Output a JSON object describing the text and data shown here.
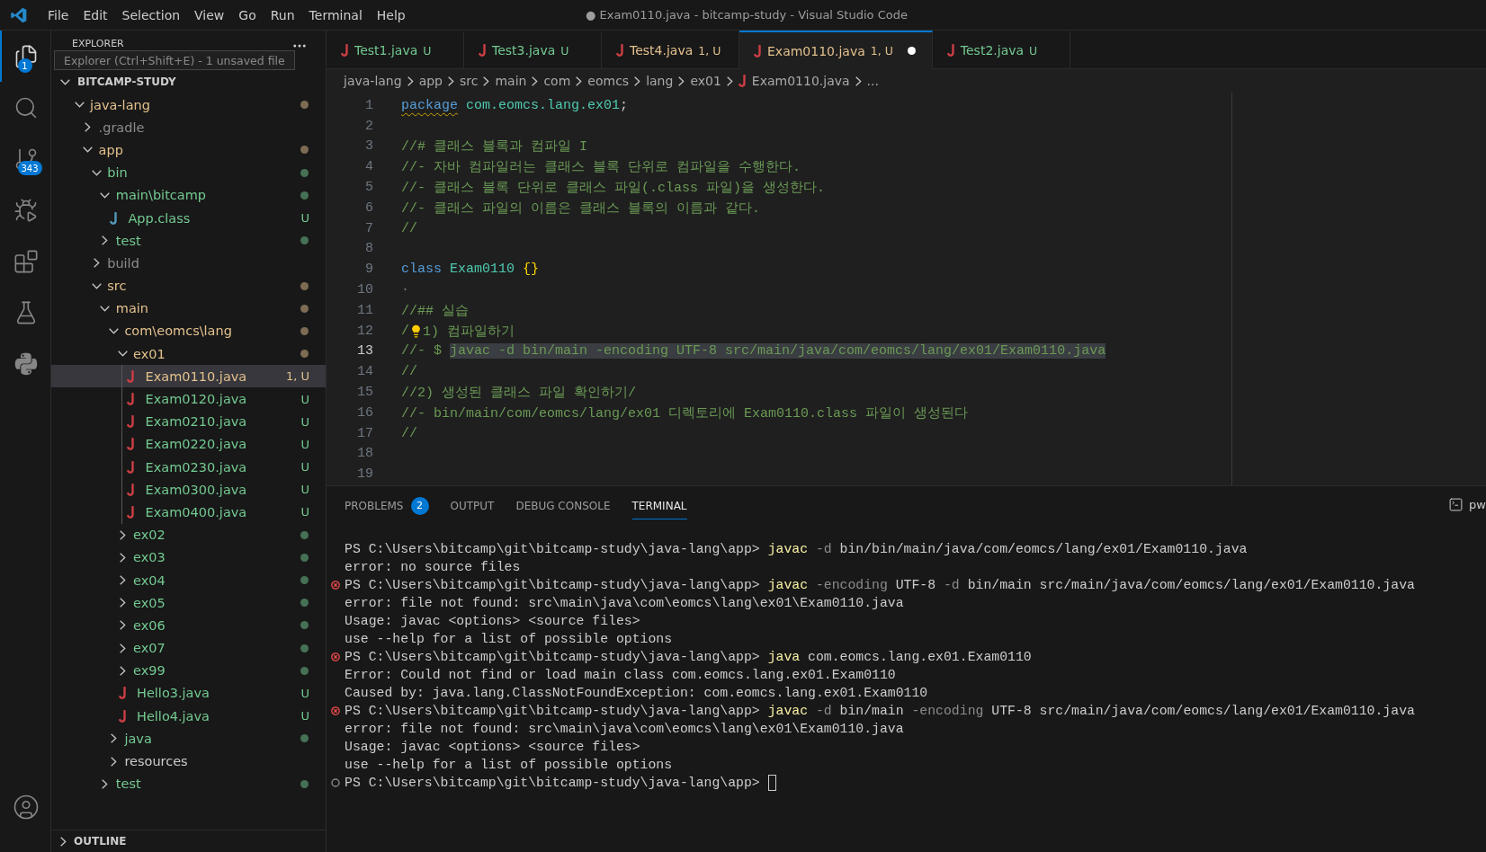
{
  "window": {
    "title": "● Exam0110.java - bitcamp-study - Visual Studio Code"
  },
  "menu": [
    "File",
    "Edit",
    "Selection",
    "View",
    "Go",
    "Run",
    "Terminal",
    "Help"
  ],
  "activity_bar": [
    {
      "kind": "files",
      "selected": true,
      "badge": "1"
    },
    {
      "kind": "search",
      "selected": false
    },
    {
      "kind": "source-control",
      "selected": false,
      "badge": "343"
    },
    {
      "kind": "run-debug",
      "selected": false
    },
    {
      "kind": "extensions",
      "selected": false
    },
    {
      "kind": "testing",
      "selected": false
    },
    {
      "kind": "python",
      "selected": false
    }
  ],
  "sidebar": {
    "header": "EXPLORER",
    "tooltip": "Explorer (Ctrl+Shift+E) - 1 unsaved file",
    "tree": {
      "title": "BITCAMP-STUDY",
      "expanded": true,
      "items": [
        {
          "label": "java-lang",
          "kind": "folder",
          "expanded": true,
          "color": "#e2c08d",
          "dot": true,
          "selected": false,
          "children": [
            {
              "label": ".gradle",
              "kind": "folder",
              "expanded": false,
              "color": "#8c8c8c",
              "dot": false,
              "selected": false
            },
            {
              "label": "app",
              "kind": "folder",
              "expanded": true,
              "color": "#e2c08d",
              "dot": true,
              "selected": false,
              "children": [
                {
                  "label": "bin",
                  "kind": "folder",
                  "expanded": true,
                  "color": "#73c991",
                  "dot": true,
                  "selected": false,
                  "children": [
                    {
                      "label": "main\\bitcamp",
                      "kind": "folder",
                      "expanded": true,
                      "color": "#73c991",
                      "dot": true,
                      "selected": false,
                      "children": [
                        {
                          "label": "App.class",
                          "kind": "class",
                          "color": "#73c991",
                          "badge": "U",
                          "selected": false
                        }
                      ]
                    },
                    {
                      "label": "test",
                      "kind": "folder",
                      "expanded": false,
                      "color": "#73c991",
                      "dot": true,
                      "selected": false
                    }
                  ]
                },
                {
                  "label": "build",
                  "kind": "folder",
                  "expanded": false,
                  "color": "#8c8c8c",
                  "dot": false,
                  "selected": false
                },
                {
                  "label": "src",
                  "kind": "folder",
                  "expanded": true,
                  "color": "#e2c08d",
                  "dot": true,
                  "selected": false,
                  "children": [
                    {
                      "label": "main",
                      "kind": "folder",
                      "expanded": true,
                      "color": "#e2c08d",
                      "dot": true,
                      "selected": false,
                      "children": [
                        {
                          "label": "com\\eomcs\\lang",
                          "kind": "folder",
                          "expanded": true,
                          "color": "#e2c08d",
                          "dot": true,
                          "selected": false,
                          "children": [
                            {
                              "label": "ex01",
                              "kind": "folder",
                              "expanded": true,
                              "color": "#e2c08d",
                              "dot": true,
                              "selected": false,
                              "children": [
                                {
                                  "label": "Exam0110.java",
                                  "kind": "java",
                                  "color": "#e2c08d",
                                  "badge": "1, U",
                                  "selected": true
                                },
                                {
                                  "label": "Exam0120.java",
                                  "kind": "java",
                                  "color": "#73c991",
                                  "badge": "U",
                                  "selected": false
                                },
                                {
                                  "label": "Exam0210.java",
                                  "kind": "java",
                                  "color": "#73c991",
                                  "badge": "U",
                                  "selected": false
                                },
                                {
                                  "label": "Exam0220.java",
                                  "kind": "java",
                                  "color": "#73c991",
                                  "badge": "U",
                                  "selected": false
                                },
                                {
                                  "label": "Exam0230.java",
                                  "kind": "java",
                                  "color": "#73c991",
                                  "badge": "U",
                                  "selected": false
                                },
                                {
                                  "label": "Exam0300.java",
                                  "kind": "java",
                                  "color": "#73c991",
                                  "badge": "U",
                                  "selected": false
                                },
                                {
                                  "label": "Exam0400.java",
                                  "kind": "java",
                                  "color": "#73c991",
                                  "badge": "U",
                                  "selected": false
                                }
                              ]
                            },
                            {
                              "label": "ex02",
                              "kind": "folder",
                              "expanded": false,
                              "color": "#73c991",
                              "dot": true,
                              "selected": false
                            },
                            {
                              "label": "ex03",
                              "kind": "folder",
                              "expanded": false,
                              "color": "#73c991",
                              "dot": true,
                              "selected": false
                            },
                            {
                              "label": "ex04",
                              "kind": "folder",
                              "expanded": false,
                              "color": "#73c991",
                              "dot": true,
                              "selected": false
                            },
                            {
                              "label": "ex05",
                              "kind": "folder",
                              "expanded": false,
                              "color": "#73c991",
                              "dot": true,
                              "selected": false
                            },
                            {
                              "label": "ex06",
                              "kind": "folder",
                              "expanded": false,
                              "color": "#73c991",
                              "dot": true,
                              "selected": false
                            },
                            {
                              "label": "ex07",
                              "kind": "folder",
                              "expanded": false,
                              "color": "#73c991",
                              "dot": true,
                              "selected": false
                            },
                            {
                              "label": "ex99",
                              "kind": "folder",
                              "expanded": false,
                              "color": "#73c991",
                              "dot": true,
                              "selected": false
                            },
                            {
                              "label": "Hello3.java",
                              "kind": "java",
                              "color": "#73c991",
                              "badge": "U",
                              "selected": false
                            },
                            {
                              "label": "Hello4.java",
                              "kind": "java",
                              "color": "#73c991",
                              "badge": "U",
                              "selected": false
                            }
                          ]
                        },
                        {
                          "label": "java",
                          "kind": "folder",
                          "expanded": false,
                          "color": "#73c991",
                          "dot": true,
                          "selected": false
                        },
                        {
                          "label": "resources",
                          "kind": "folder",
                          "expanded": false,
                          "color": "#cccccc",
                          "dot": false,
                          "selected": false
                        }
                      ]
                    },
                    {
                      "label": "test",
                      "kind": "folder",
                      "expanded": false,
                      "color": "#73c991",
                      "dot": true,
                      "selected": false
                    }
                  ]
                }
              ]
            }
          ]
        }
      ]
    },
    "outline": {
      "title": "OUTLINE",
      "expanded": false
    }
  },
  "tabs": [
    {
      "label": "Test1.java",
      "badge": "U",
      "color": "#73c991",
      "selected": false,
      "dirty": false
    },
    {
      "label": "Test3.java",
      "badge": "U",
      "color": "#73c991",
      "selected": false,
      "dirty": false
    },
    {
      "label": "Test4.java",
      "badge": "1, U",
      "color": "#e2c08d",
      "selected": false,
      "dirty": false
    },
    {
      "label": "Exam0110.java",
      "badge": "1, U",
      "color": "#e2c08d",
      "selected": true,
      "dirty": true
    },
    {
      "label": "Test2.java",
      "badge": "U",
      "color": "#73c991",
      "selected": false,
      "dirty": false
    }
  ],
  "breadcrumb": [
    {
      "label": "java-lang"
    },
    {
      "label": "app"
    },
    {
      "label": "src"
    },
    {
      "label": "main"
    },
    {
      "label": "com"
    },
    {
      "label": "eomcs"
    },
    {
      "label": "lang"
    },
    {
      "label": "ex01"
    },
    {
      "label": "Exam0110.java",
      "file": true
    },
    {
      "label": "..."
    }
  ],
  "editor": {
    "lines": [
      {
        "number": "1",
        "current": false,
        "tokens": [
          {
            "text": "package",
            "kind": "keyword",
            "warning": true
          },
          {
            "text": " com.eomcs.lang.ex01",
            "kind": "namespace"
          },
          {
            "text": ";",
            "kind": "plain"
          }
        ]
      },
      {
        "number": "2",
        "current": false
      },
      {
        "number": "3",
        "current": false,
        "tokens": [
          {
            "text": "//# 클래스 블록과 컴파일 I",
            "kind": "comment"
          }
        ]
      },
      {
        "number": "4",
        "current": false,
        "tokens": [
          {
            "text": "//- 자바 컴파일러는 클래스 블록 단위로 컴파일을 수행한다.",
            "kind": "comment"
          }
        ]
      },
      {
        "number": "5",
        "current": false,
        "tokens": [
          {
            "text": "//- 클래스 블록 단위로 클래스 파일(.class 파일)을 생성한다.",
            "kind": "comment"
          }
        ]
      },
      {
        "number": "6",
        "current": false,
        "tokens": [
          {
            "text": "//- 클래스 파일의 이름은 클래스 블록의 이름과 같다.",
            "kind": "comment"
          }
        ]
      },
      {
        "number": "7",
        "current": false,
        "tokens": [
          {
            "text": "//",
            "kind": "comment"
          }
        ]
      },
      {
        "number": "8",
        "current": false
      },
      {
        "number": "9",
        "current": false,
        "tokens": [
          {
            "text": "class",
            "kind": "keyword"
          },
          {
            "text": " Exam0110",
            "kind": "type"
          },
          {
            "text": " {}",
            "kind": "brace"
          }
        ]
      },
      {
        "number": "10",
        "current": false,
        "tokens": [
          {
            "text": "·",
            "kind": "whitespace"
          }
        ]
      },
      {
        "number": "11",
        "current": false,
        "tokens": [
          {
            "text": "//## 실습",
            "kind": "comment"
          }
        ]
      },
      {
        "number": "12",
        "current": false,
        "tokens": [
          {
            "text": "/",
            "kind": "comment"
          },
          {
            "kind": "bulb"
          },
          {
            "text": "1) 컴파일하기",
            "kind": "comment"
          }
        ]
      },
      {
        "number": "13",
        "current": true,
        "tokens": [
          {
            "text": "//- $ ",
            "kind": "comment"
          },
          {
            "text": "javac -d bin/main -encoding UTF-8 src/main/java/com/eomcs/lang/ex01/Exam0110.java",
            "kind": "match"
          }
        ]
      },
      {
        "number": "14",
        "current": false,
        "tokens": [
          {
            "text": "//",
            "kind": "comment"
          }
        ]
      },
      {
        "number": "15",
        "current": false,
        "tokens": [
          {
            "text": "//2) 생성된 클래스 파일 확인하기/",
            "kind": "comment"
          }
        ]
      },
      {
        "number": "16",
        "current": false,
        "tokens": [
          {
            "text": "//- bin/main/com/eomcs/lang/ex01 디렉토리에 Exam0110.class 파일이 생성된다",
            "kind": "comment"
          }
        ]
      },
      {
        "number": "17",
        "current": false,
        "tokens": [
          {
            "text": "//",
            "kind": "comment"
          }
        ]
      },
      {
        "number": "18",
        "current": false
      },
      {
        "number": "19",
        "current": false
      }
    ]
  },
  "panel": {
    "tabs": [
      {
        "label": "PROBLEMS",
        "badge": "2",
        "selected": false
      },
      {
        "label": "OUTPUT",
        "selected": false
      },
      {
        "label": "DEBUG CONSOLE",
        "selected": false
      },
      {
        "label": "TERMINAL",
        "selected": true
      }
    ],
    "terminal_name": "pw",
    "terminal": [
      {
        "kind": "plain",
        "tokens": [
          {
            "text": "PS C:\\Users\\bitcamp\\git\\bitcamp-study\\java-lang\\app> ",
            "kind": "text"
          },
          {
            "text": "javac",
            "kind": "cmd"
          },
          {
            "text": " -d",
            "kind": "flag"
          },
          {
            "text": " bin/bin/main/java/com/eomcs/lang/ex01/Exam0110.java",
            "kind": "text"
          }
        ]
      },
      {
        "kind": "plain",
        "tokens": [
          {
            "text": "error: no source files",
            "kind": "text"
          }
        ]
      },
      {
        "kind": "error",
        "tokens": [
          {
            "text": "PS C:\\Users\\bitcamp\\git\\bitcamp-study\\java-lang\\app> ",
            "kind": "text"
          },
          {
            "text": "javac",
            "kind": "cmd"
          },
          {
            "text": " -encoding",
            "kind": "flag"
          },
          {
            "text": " UTF-8",
            "kind": "text"
          },
          {
            "text": " -d",
            "kind": "flag"
          },
          {
            "text": " bin/main src/main/java/com/eomcs/lang/ex01/Exam0110.java",
            "kind": "text"
          }
        ]
      },
      {
        "kind": "plain",
        "tokens": [
          {
            "text": "error: file not found: src\\main\\java\\com\\eomcs\\lang\\ex01\\Exam0110.java",
            "kind": "text"
          }
        ]
      },
      {
        "kind": "plain",
        "tokens": [
          {
            "text": "Usage: javac <options> <source files>",
            "kind": "text"
          }
        ]
      },
      {
        "kind": "plain",
        "tokens": [
          {
            "text": "use --help for a list of possible options",
            "kind": "text"
          }
        ]
      },
      {
        "kind": "error",
        "tokens": [
          {
            "text": "PS C:\\Users\\bitcamp\\git\\bitcamp-study\\java-lang\\app> ",
            "kind": "text"
          },
          {
            "text": "java",
            "kind": "cmd"
          },
          {
            "text": " com.eomcs.lang.ex01.Exam0110",
            "kind": "text"
          }
        ]
      },
      {
        "kind": "plain",
        "tokens": [
          {
            "text": "Error: Could not find or load main class com.eomcs.lang.ex01.Exam0110",
            "kind": "text"
          }
        ]
      },
      {
        "kind": "plain",
        "tokens": [
          {
            "text": "Caused by: java.lang.ClassNotFoundException: com.eomcs.lang.ex01.Exam0110",
            "kind": "text"
          }
        ]
      },
      {
        "kind": "error",
        "tokens": [
          {
            "text": "PS C:\\Users\\bitcamp\\git\\bitcamp-study\\java-lang\\app> ",
            "kind": "text"
          },
          {
            "text": "javac",
            "kind": "cmd"
          },
          {
            "text": " -d",
            "kind": "flag"
          },
          {
            "text": " bin/main",
            "kind": "text"
          },
          {
            "text": " -encoding",
            "kind": "flag"
          },
          {
            "text": " UTF-8 src/main/java/com/eomcs/lang/ex01/Exam0110.java",
            "kind": "text"
          }
        ]
      },
      {
        "kind": "plain",
        "tokens": [
          {
            "text": "error: file not found: src\\main\\java\\com\\eomcs\\lang\\ex01\\Exam0110.java",
            "kind": "text"
          }
        ]
      },
      {
        "kind": "plain",
        "tokens": [
          {
            "text": "Usage: javac <options> <source files>",
            "kind": "text"
          }
        ]
      },
      {
        "kind": "plain",
        "tokens": [
          {
            "text": "use --help for a list of possible options",
            "kind": "text"
          }
        ]
      },
      {
        "kind": "idle",
        "cursor": true,
        "tokens": [
          {
            "text": "PS C:\\Users\\bitcamp\\git\\bitcamp-study\\java-lang\\app> ",
            "kind": "text"
          }
        ]
      }
    ]
  }
}
